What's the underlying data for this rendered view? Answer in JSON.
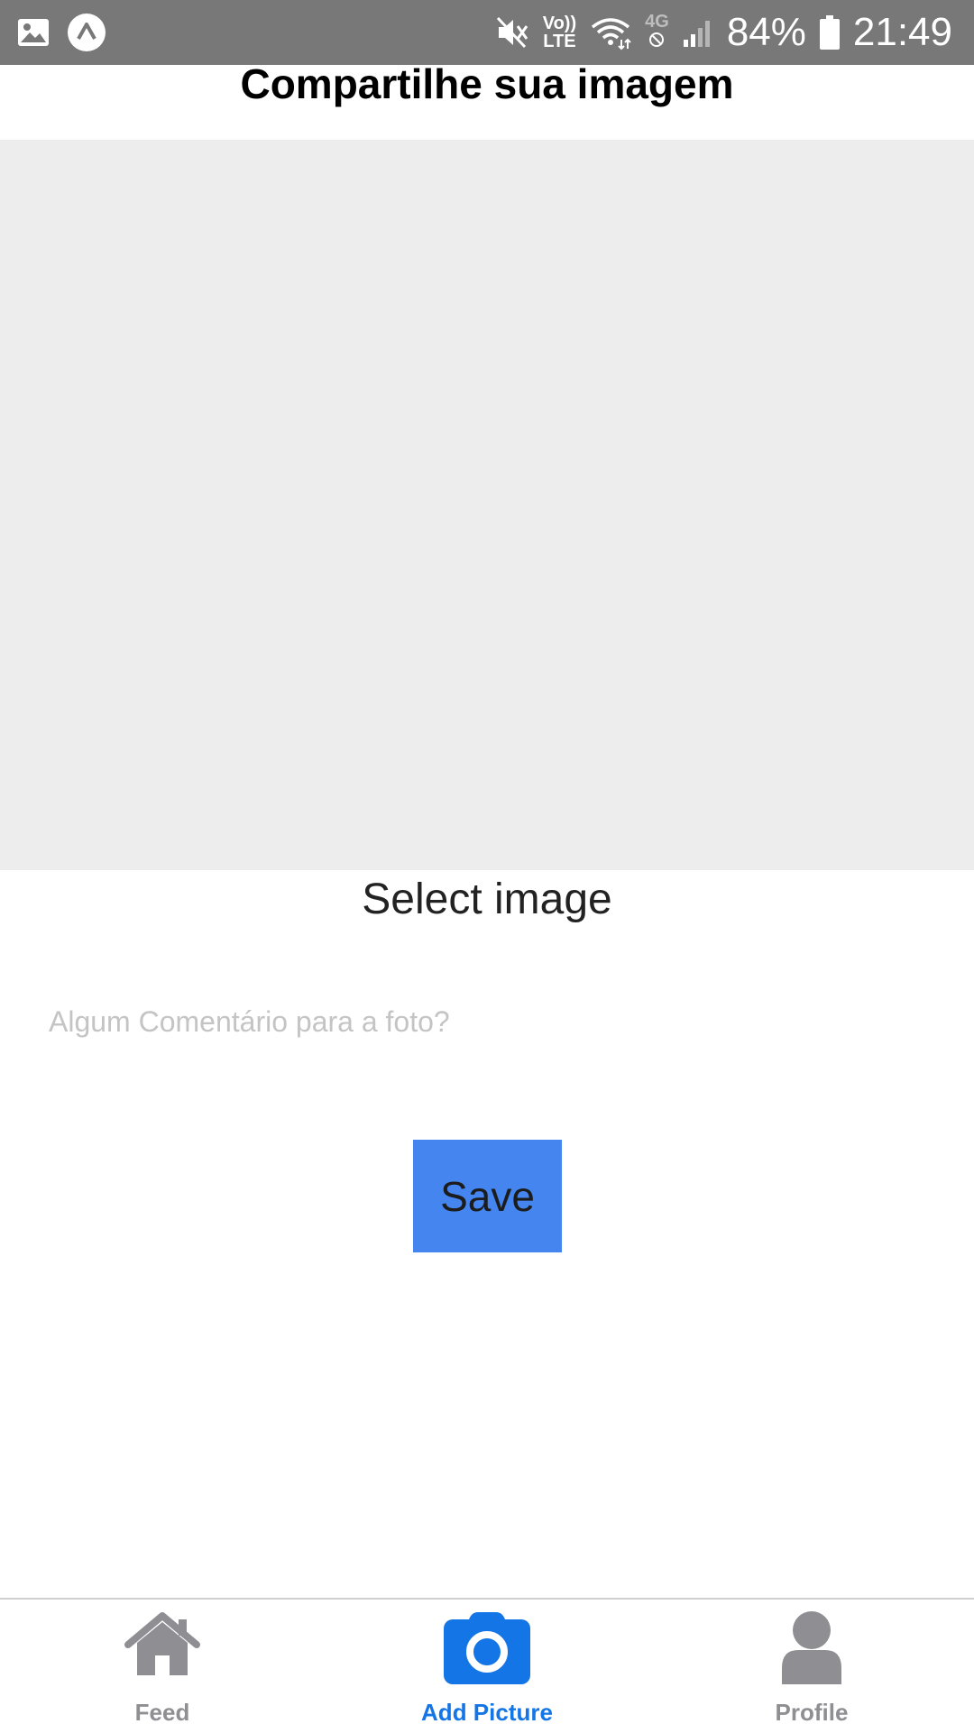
{
  "status_bar": {
    "battery": "84%",
    "time": "21:49",
    "network_volte_top": "Vo))",
    "network_volte_bottom": "LTE",
    "network_4g": "4G"
  },
  "header": {
    "title": "Compartilhe sua imagem"
  },
  "main": {
    "select_image_label": "Select image",
    "comment_placeholder": "Algum Comentário para a foto?",
    "comment_value": "",
    "save_label": "Save"
  },
  "tabs": [
    {
      "label": "Feed",
      "icon": "home-icon",
      "active": false
    },
    {
      "label": "Add Picture",
      "icon": "camera-icon",
      "active": true
    },
    {
      "label": "Profile",
      "icon": "user-icon",
      "active": false
    }
  ],
  "colors": {
    "status_bar_bg": "#787878",
    "image_placeholder_bg": "#ededed",
    "save_button_bg": "#4485f0",
    "tab_active": "#1475e6",
    "tab_inactive": "#8e8e93"
  }
}
